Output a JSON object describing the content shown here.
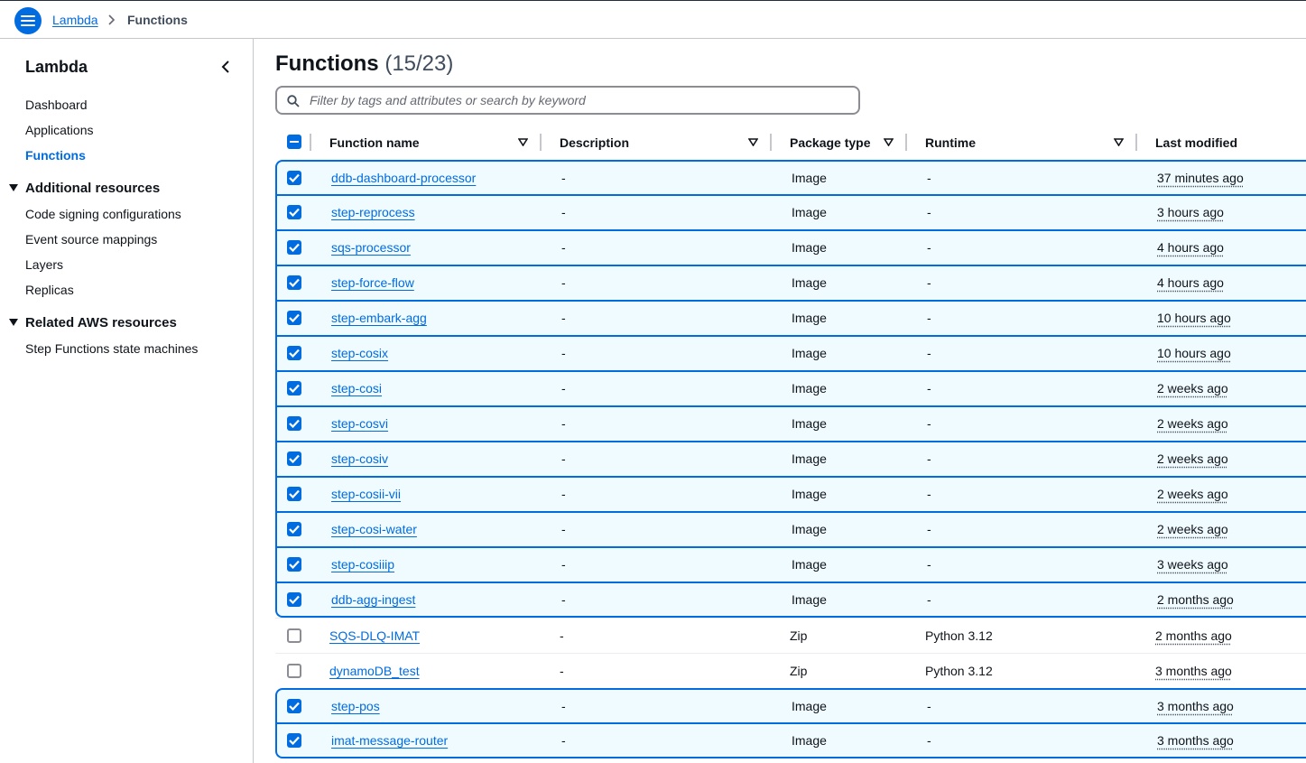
{
  "breadcrumb": {
    "parent": "Lambda",
    "current": "Functions"
  },
  "sidebar": {
    "title": "Lambda",
    "items": [
      "Dashboard",
      "Applications",
      "Functions"
    ],
    "active": "Functions",
    "sections": [
      {
        "title": "Additional resources",
        "items": [
          "Code signing configurations",
          "Event source mappings",
          "Layers",
          "Replicas"
        ]
      },
      {
        "title": "Related AWS resources",
        "items": [
          "Step Functions state machines"
        ]
      }
    ]
  },
  "main": {
    "title": "Functions",
    "count": "(15/23)",
    "search_placeholder": "Filter by tags and attributes or search by keyword"
  },
  "table": {
    "columns": [
      "Function name",
      "Description",
      "Package type",
      "Runtime",
      "Last modified"
    ],
    "rows": [
      {
        "selected": true,
        "name": "ddb-dashboard-processor",
        "description": "-",
        "package": "Image",
        "runtime": "-",
        "modified": "37 minutes ago"
      },
      {
        "selected": true,
        "name": "step-reprocess",
        "description": "-",
        "package": "Image",
        "runtime": "-",
        "modified": "3 hours ago"
      },
      {
        "selected": true,
        "name": "sqs-processor",
        "description": "-",
        "package": "Image",
        "runtime": "-",
        "modified": "4 hours ago"
      },
      {
        "selected": true,
        "name": "step-force-flow",
        "description": "-",
        "package": "Image",
        "runtime": "-",
        "modified": "4 hours ago"
      },
      {
        "selected": true,
        "name": "step-embark-agg",
        "description": "-",
        "package": "Image",
        "runtime": "-",
        "modified": "10 hours ago"
      },
      {
        "selected": true,
        "name": "step-cosix",
        "description": "-",
        "package": "Image",
        "runtime": "-",
        "modified": "10 hours ago"
      },
      {
        "selected": true,
        "name": "step-cosi",
        "description": "-",
        "package": "Image",
        "runtime": "-",
        "modified": "2 weeks ago"
      },
      {
        "selected": true,
        "name": "step-cosvi",
        "description": "-",
        "package": "Image",
        "runtime": "-",
        "modified": "2 weeks ago"
      },
      {
        "selected": true,
        "name": "step-cosiv",
        "description": "-",
        "package": "Image",
        "runtime": "-",
        "modified": "2 weeks ago"
      },
      {
        "selected": true,
        "name": "step-cosii-vii",
        "description": "-",
        "package": "Image",
        "runtime": "-",
        "modified": "2 weeks ago"
      },
      {
        "selected": true,
        "name": "step-cosi-water",
        "description": "-",
        "package": "Image",
        "runtime": "-",
        "modified": "2 weeks ago"
      },
      {
        "selected": true,
        "name": "step-cosiiip",
        "description": "-",
        "package": "Image",
        "runtime": "-",
        "modified": "3 weeks ago"
      },
      {
        "selected": true,
        "name": "ddb-agg-ingest",
        "description": "-",
        "package": "Image",
        "runtime": "-",
        "modified": "2 months ago"
      },
      {
        "selected": false,
        "name": "SQS-DLQ-IMAT",
        "description": "-",
        "package": "Zip",
        "runtime": "Python 3.12",
        "modified": "2 months ago"
      },
      {
        "selected": false,
        "name": "dynamoDB_test",
        "description": "-",
        "package": "Zip",
        "runtime": "Python 3.12",
        "modified": "3 months ago"
      },
      {
        "selected": true,
        "name": "step-pos",
        "description": "-",
        "package": "Image",
        "runtime": "-",
        "modified": "3 months ago"
      },
      {
        "selected": true,
        "name": "imat-message-router",
        "description": "-",
        "package": "Image",
        "runtime": "-",
        "modified": "3 months ago"
      }
    ]
  },
  "colors": {
    "accent": "#006ce0",
    "selected_bg": "#f0fbff",
    "border": "#c6c6cd",
    "text": "#0f141a"
  },
  "icons": {
    "menu": "hamburger-icon",
    "search": "search-icon",
    "collapse": "chevron-left-icon",
    "sort": "sort-triangle-icon"
  }
}
